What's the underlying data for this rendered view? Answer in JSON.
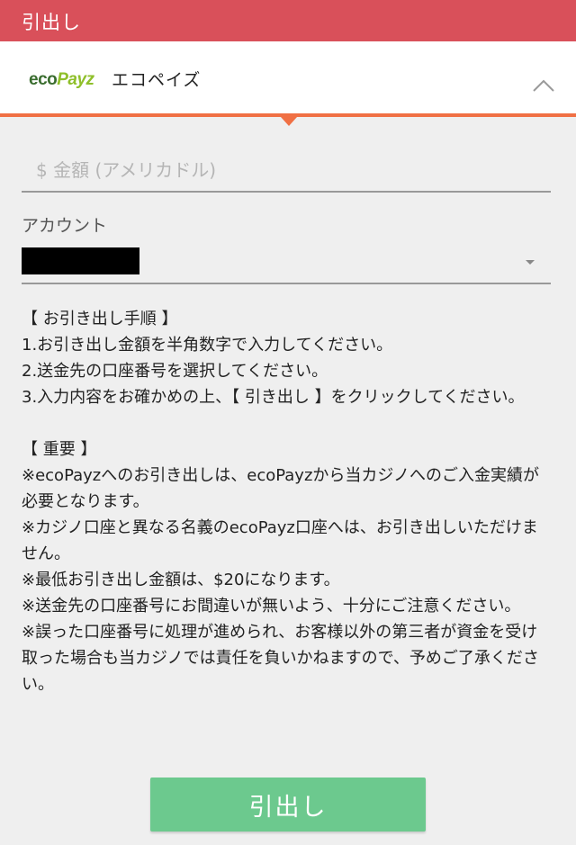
{
  "header": {
    "title": "引出し"
  },
  "method": {
    "logo_part1": "eco",
    "logo_part2": "Payz",
    "name": "エコペイズ"
  },
  "form": {
    "amount_placeholder": "$ 金額 (アメリカドル)",
    "amount_value": "",
    "account_label": "アカウント"
  },
  "instructions": {
    "procedure_heading": "【 お引き出し手順 】",
    "steps": [
      "1.お引き出し金額を半角数字で入力してください。",
      "2.送金先の口座番号を選択してください。",
      "3.入力内容をお確かめの上、【 引き出し 】をクリックしてください。"
    ],
    "important_heading": "【 重要 】",
    "notes": [
      "※ecoPayzへのお引き出しは、ecoPayzから当カジノへのご入金実績が必要となります。",
      "※カジノ口座と異なる名義のecoPayz口座へは、お引き出しいただけません。",
      "※最低お引き出し金額は、$20になります。",
      "※送金先の口座番号にお間違いが無いよう、十分にご注意ください。",
      "※誤った口座番号に処理が進められ、お客様以外の第三者が資金を受け取った場合も当カジノでは責任を負いかねますので、予めご了承ください。"
    ]
  },
  "actions": {
    "withdraw_label": "引出し"
  },
  "colors": {
    "header_bg": "#d9505a",
    "accent_line": "#f07044",
    "button_bg": "#6cc98e"
  }
}
